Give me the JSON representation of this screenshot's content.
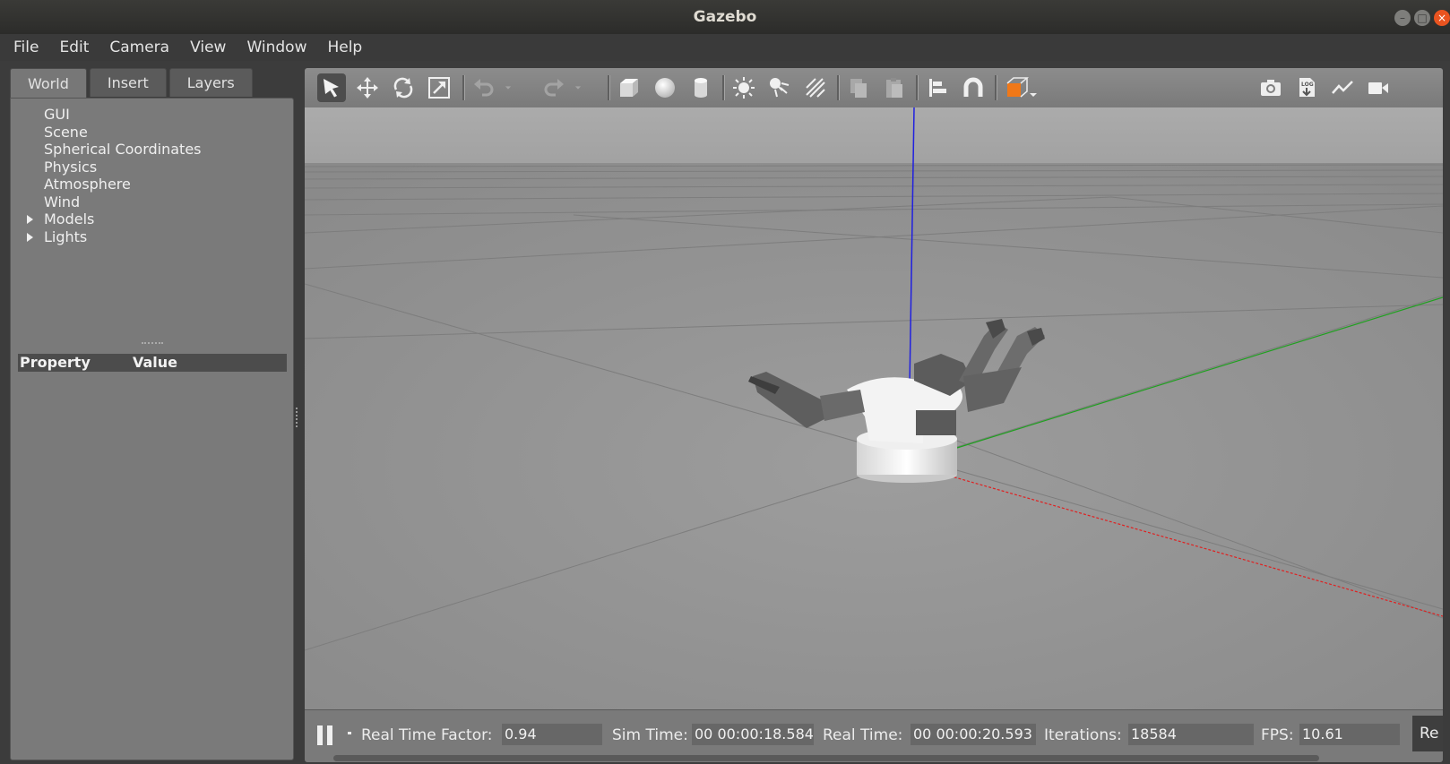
{
  "window": {
    "title": "Gazebo"
  },
  "menu": [
    "File",
    "Edit",
    "Camera",
    "View",
    "Window",
    "Help"
  ],
  "tabs": [
    "World",
    "Insert",
    "Layers"
  ],
  "tree": [
    {
      "label": "GUI",
      "expandable": false
    },
    {
      "label": "Scene",
      "expandable": false
    },
    {
      "label": "Spherical Coordinates",
      "expandable": false
    },
    {
      "label": "Physics",
      "expandable": false
    },
    {
      "label": "Atmosphere",
      "expandable": false
    },
    {
      "label": "Wind",
      "expandable": false
    },
    {
      "label": "Models",
      "expandable": true
    },
    {
      "label": "Lights",
      "expandable": true
    }
  ],
  "properties": {
    "col_property": "Property",
    "col_value": "Value"
  },
  "toolbar": {
    "tools": [
      "select-arrow-icon",
      "translate-icon",
      "rotate-icon",
      "scale-icon",
      "undo-icon",
      "undo-dropdown-icon",
      "redo-icon",
      "redo-dropdown-icon",
      "box-shape-icon",
      "sphere-shape-icon",
      "cylinder-shape-icon",
      "point-light-icon",
      "spot-light-icon",
      "directional-light-icon",
      "copy-icon",
      "paste-icon",
      "align-icon",
      "snap-magnet-icon",
      "view-angle-icon",
      "screenshot-camera-icon",
      "log-record-icon",
      "plot-icon",
      "video-record-icon"
    ],
    "accent": "#f07818"
  },
  "status": {
    "rtf_label": "Real Time Factor:",
    "rtf_value": "0.94",
    "sim_label": "Sim Time:",
    "sim_value": "00 00:00:18.584",
    "real_label": "Real Time:",
    "real_value": "00 00:00:20.593",
    "iter_label": "Iterations:",
    "iter_value": "18584",
    "fps_label": "FPS:",
    "fps_value": "10.61",
    "reset_label": "Re"
  },
  "colors": {
    "axis_z": "#2020e0",
    "axis_x": "#e02020",
    "axis_y": "#20a020"
  }
}
